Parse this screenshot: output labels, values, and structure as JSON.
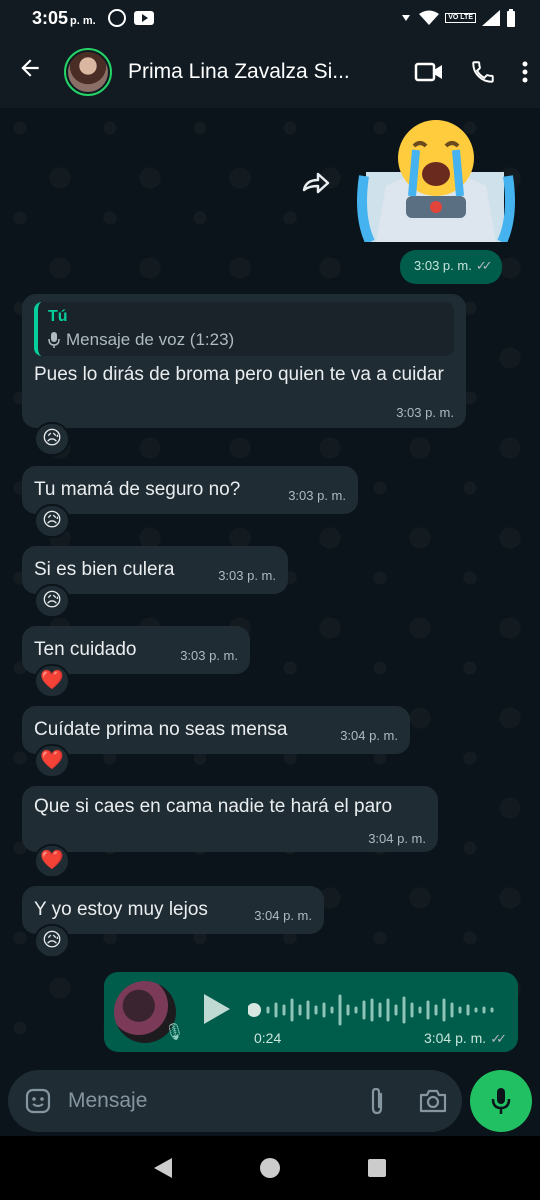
{
  "status": {
    "time": "3:05",
    "ampm": "p. m.",
    "lte": "VO LTE"
  },
  "header": {
    "contact_name": "Prima Lina Zavalza Si..."
  },
  "messages": [
    {
      "id": "m0",
      "time": "3:03 p. m."
    },
    {
      "id": "m1",
      "reply_author": "Tú",
      "reply_text": "Mensaje de voz (1:23)",
      "text": "Pues lo dirás de broma pero quien te va a cuidar",
      "time": "3:03 p. m.",
      "reaction": "😥"
    },
    {
      "id": "m2",
      "text": "Tu mamá de seguro no?",
      "time": "3:03 p. m.",
      "reaction": "😥"
    },
    {
      "id": "m3",
      "text": "Si es bien culera",
      "time": "3:03 p. m.",
      "reaction": "😥"
    },
    {
      "id": "m4",
      "text": "Ten cuidado",
      "time": "3:03 p. m.",
      "reaction": "❤️"
    },
    {
      "id": "m5",
      "text": "Cuídate prima no seas mensa",
      "time": "3:04 p. m.",
      "reaction": "❤️"
    },
    {
      "id": "m6",
      "text": "Que si caes en cama nadie te hará el paro",
      "time": "3:04 p. m.",
      "reaction": "❤️"
    },
    {
      "id": "m7",
      "text": "Y yo estoy muy lejos",
      "time": "3:04 p. m.",
      "reaction": "😥"
    }
  ],
  "voice": {
    "duration": "0:24",
    "time": "3:04 p. m."
  },
  "input": {
    "placeholder": "Mensaje"
  },
  "colors": {
    "accent": "#25d366",
    "outgoing": "#005c4b",
    "incoming": "#202c33",
    "background": "#0b141a"
  }
}
